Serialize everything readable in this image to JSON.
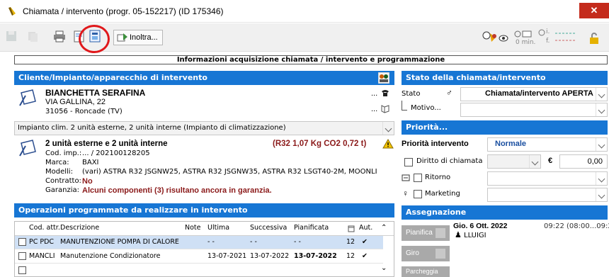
{
  "window": {
    "title": "Chiamata / intervento  (progr. 05-152217) (ID 175346)",
    "close_label": "✕"
  },
  "toolbar": {
    "inoltra_label": "Inoltra...",
    "timer_a": "0",
    "timer_b": "0 min.",
    "flag_i": "i.",
    "flag_f": "f."
  },
  "banner": "Informazioni acquisizione chiamata / intervento e programmazione",
  "cliente": {
    "header": "Cliente/Impianto/apparecchio di intervento",
    "name": "BIANCHETTA SERAFINA",
    "address": "VIA GALLINA, 22",
    "city": "31056 - Roncade (TV)",
    "impianto_combo": "Impianto clim.  2 unità esterne, 2 unità interne (Impianto di climatizzazione)",
    "unit_title": "2 unità esterne e 2 unità interne",
    "gas_info": "(R32  1,07 Kg  CO2 0,72 t)",
    "cod_imp_label": "Cod. imp.:",
    "cod_imp_value": "... / 202100128205",
    "marca_label": "Marca:",
    "marca_value": "BAXI",
    "modelli_label": "Modelli:",
    "modelli_value": "(vari) ASTRA R32  JSGNW25, ASTRA R32  JSGNW35, ASTRA R32 LSGT40-2M, MOONLI",
    "contratto_label": "Contratto:",
    "contratto_value": "No",
    "garanzia_label": "Garanzia:",
    "garanzia_value": "Alcuni componenti (3) risultano ancora in garanzia.",
    "ellipsis": "..."
  },
  "operazioni": {
    "header": "Operazioni programmate da realizzare in intervento",
    "columns": [
      "Cod. attr.",
      "Descrizione",
      "Note",
      "Ultima",
      "Successiva",
      "Pianificata",
      "",
      "Aut."
    ],
    "rows": [
      {
        "cod": "PC PDC",
        "desc": "MANUTENZIONE POMPA DI CALORE",
        "note": "",
        "ultima": "- -",
        "successiva": "- -",
        "pianificata": "- -",
        "n": "12",
        "aut": "✔"
      },
      {
        "cod": "MANCLI",
        "desc": "Manutenzione Condizionatore",
        "note": "",
        "ultima": "13-07-2021",
        "successiva": "13-07-2022",
        "pianificata": "13-07-2022",
        "n": "12",
        "aut": "✔"
      }
    ]
  },
  "stato": {
    "header": "Stato della chiamata/intervento",
    "stato_label": "Stato",
    "stato_value": "Chiamata/intervento APERTA",
    "motivo_label": "Motivo..."
  },
  "priorita": {
    "header": "Priorità...",
    "label": "Priorità intervento",
    "value": "Normale",
    "diritto_label": "Diritto di chiamata",
    "currency": "€",
    "amount": "0,00",
    "ritorno_label": "Ritorno",
    "marketing_label": "Marketing"
  },
  "assegnazione": {
    "header": "Assegnazione",
    "pianifica_label": "Pianifica",
    "giro_label": "Giro",
    "parcheggia_label": "Parcheggia",
    "date": "Gio. 6 Ott. 2022",
    "time": "09:22 (08:00...09:22)",
    "tech": "LLUIGI"
  }
}
